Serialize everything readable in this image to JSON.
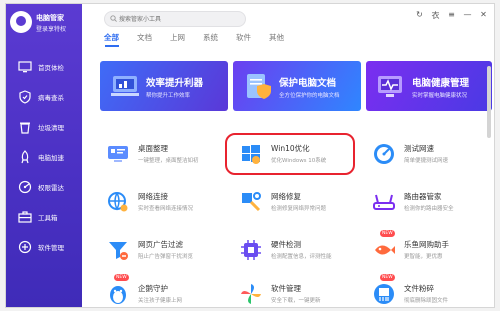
{
  "sidebar": {
    "app_name": "电脑管家",
    "login_text": "登录享特权",
    "items": [
      {
        "label": "首页体检",
        "icon": "monitor-check-icon"
      },
      {
        "label": "病毒查杀",
        "icon": "virus-scan-icon"
      },
      {
        "label": "垃圾清理",
        "icon": "trash-clean-icon"
      },
      {
        "label": "电脑加速",
        "icon": "rocket-icon"
      },
      {
        "label": "权限雷达",
        "icon": "radar-icon"
      },
      {
        "label": "工具箱",
        "icon": "toolbox-icon"
      },
      {
        "label": "软件管理",
        "icon": "software-manager-icon"
      }
    ]
  },
  "search": {
    "placeholder": "搜索管家小工具"
  },
  "tabs": [
    {
      "label": "全部",
      "active": true
    },
    {
      "label": "文档"
    },
    {
      "label": "上网"
    },
    {
      "label": "系统"
    },
    {
      "label": "软件"
    },
    {
      "label": "其他"
    }
  ],
  "banners": [
    {
      "title": "效率提升利器",
      "subtitle": "帮你提升工作效率"
    },
    {
      "title": "保护电脑文档",
      "subtitle": "全方位保护你的电脑文档"
    },
    {
      "title": "电脑健康管理",
      "subtitle": "实时掌握电脑健康状况"
    }
  ],
  "tools": [
    {
      "name": "桌面整理",
      "desc": "一键整理，桌面整洁如初"
    },
    {
      "name": "Win10优化",
      "desc": "优化Windows 10系统"
    },
    {
      "name": "测试网速",
      "desc": "简单便捷测试网速"
    },
    {
      "name": "网络连接",
      "desc": "实时查看网络连接情况"
    },
    {
      "name": "网络修复",
      "desc": "检测修复网络异常问题"
    },
    {
      "name": "路由器管家",
      "desc": "检测你的路由器安全"
    },
    {
      "name": "网页广告过滤",
      "desc": "阻止广告弹窗干扰浏览"
    },
    {
      "name": "硬件检测",
      "desc": "检测配置信息，评测性能"
    },
    {
      "name": "乐鱼网购助手",
      "desc": "更智能，更优惠"
    },
    {
      "name": "企鹅守护",
      "desc": "关注孩子健康上网"
    },
    {
      "name": "软件管理",
      "desc": "安全下载，一键更新"
    },
    {
      "name": "文件粉碎",
      "desc": "彻底删除顽固文件"
    }
  ],
  "badges": {
    "new": "NEW"
  },
  "window_controls": [
    "↻",
    "衣",
    "≡",
    "—",
    "✕"
  ],
  "colors": {
    "accent": "#2f6df0",
    "sidebar": "#4b31c4",
    "highlight": "#e8232f"
  }
}
